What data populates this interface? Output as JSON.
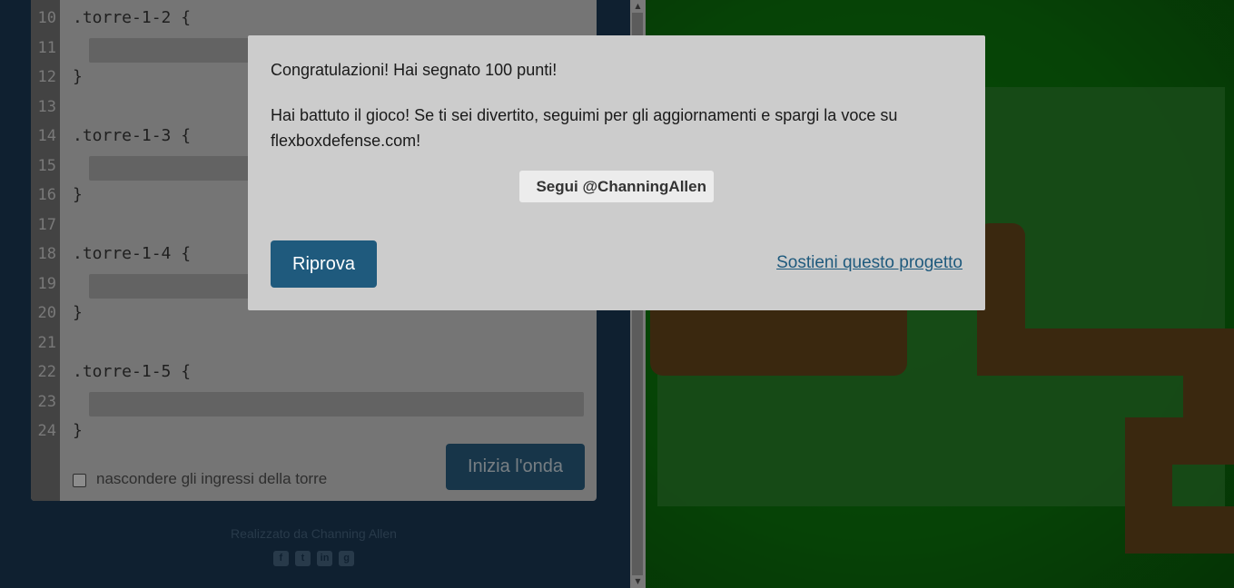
{
  "editor": {
    "line_numbers": [
      "10",
      "11",
      "12",
      "13",
      "14",
      "15",
      "16",
      "17",
      "18",
      "19",
      "20",
      "21",
      "22",
      "23",
      "24"
    ],
    "selectors": [
      ".torre-1-2 {",
      ".torre-1-3 {",
      ".torre-1-4 {",
      ".torre-1-5 {"
    ],
    "closing_brace": "}",
    "start_wave_label": "Inizia l'onda",
    "hide_inputs_label": "nascondere gli ingressi della torre"
  },
  "footer": {
    "credits": "Realizzato da Channing Allen",
    "social_icons": [
      "facebook-icon",
      "twitter-icon",
      "linkedin-icon",
      "github-icon"
    ]
  },
  "modal": {
    "title": "Congratulazioni! Hai segnato 100 punti!",
    "body": "Hai battuto il gioco! Se ti sei divertito, seguimi per gli aggiornamenti e spargi la voce su flexboxdefense.com!",
    "follow_label": "Segui @ChanningAllen",
    "retry_label": "Riprova",
    "support_label": "Sostieni questo progetto"
  },
  "colors": {
    "panel": "#1c3b58",
    "board_green": "#0a8a0a",
    "path_brown": "#6a4a1c",
    "accent": "#1f5a7d"
  }
}
